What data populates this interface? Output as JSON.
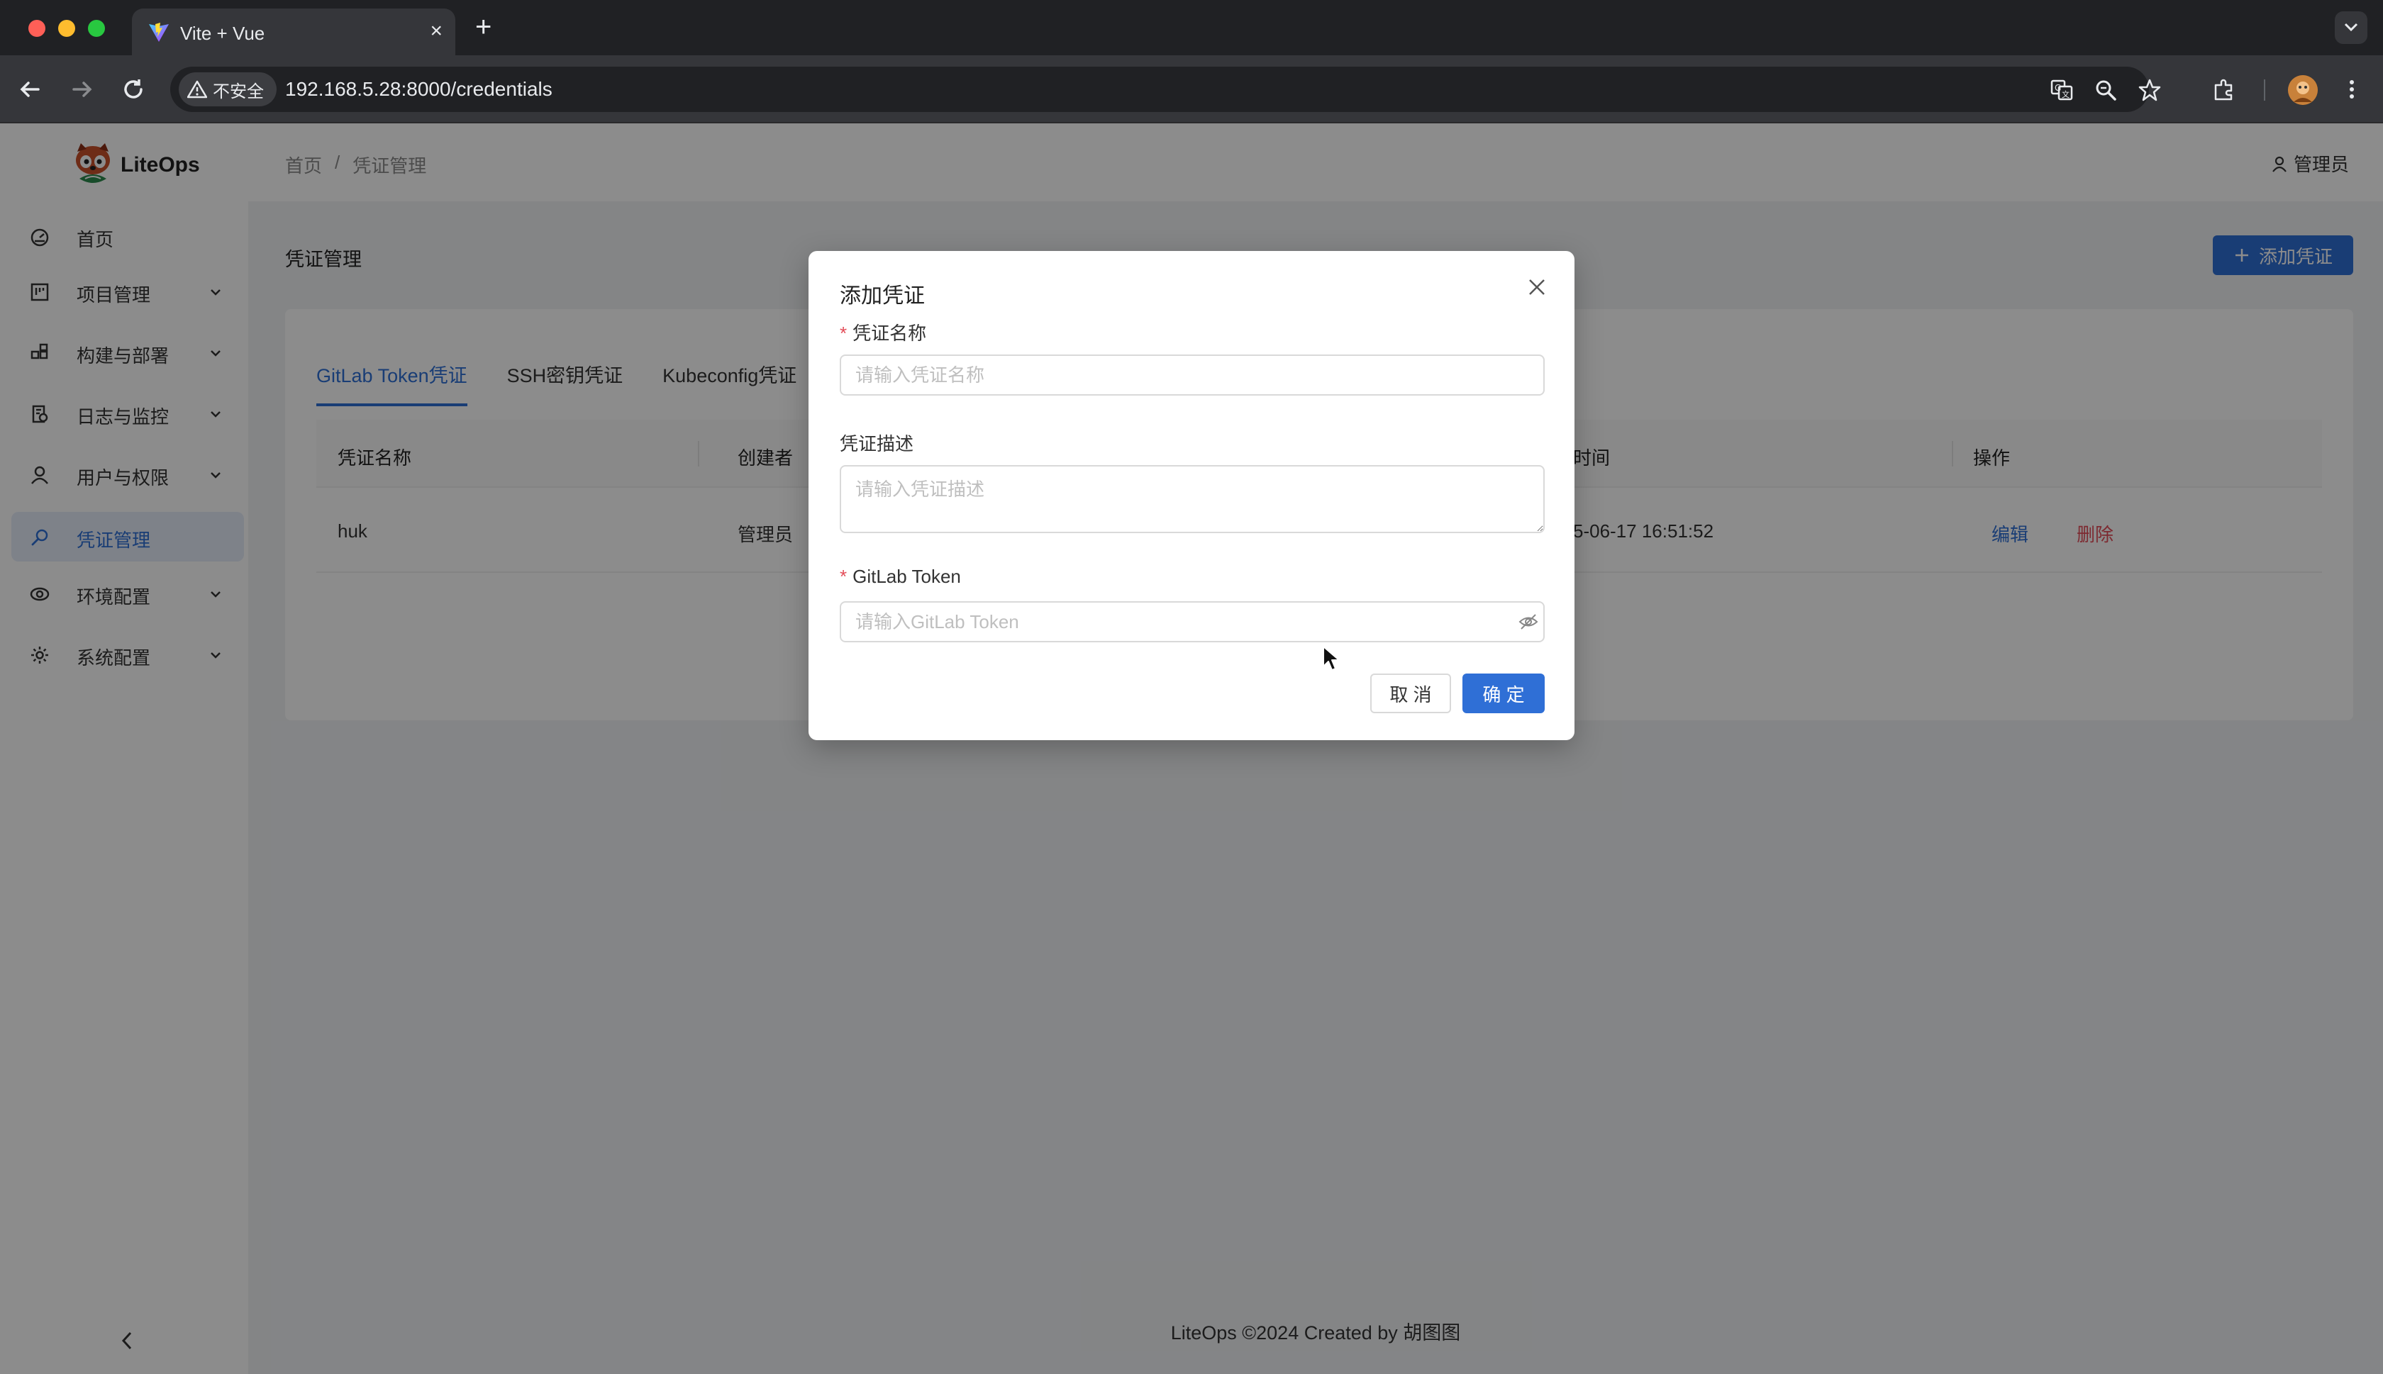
{
  "browser": {
    "tab_title": "Vite + Vue",
    "security_label": "不安全",
    "url": "192.168.5.28:8000/credentials"
  },
  "app": {
    "logo_text": "LiteOps",
    "user_name": "管理员",
    "breadcrumb": [
      "首页",
      "/",
      "凭证管理"
    ],
    "page_title": "凭证管理",
    "add_button_label": "添加凭证",
    "footer": "LiteOps ©2024 Created by 胡图图"
  },
  "sidebar": {
    "items": [
      {
        "label": "首页",
        "icon": "dashboard-icon"
      },
      {
        "label": "项目管理",
        "icon": "project-icon"
      },
      {
        "label": "构建与部署",
        "icon": "build-icon"
      },
      {
        "label": "日志与监控",
        "icon": "log-icon"
      },
      {
        "label": "用户与权限",
        "icon": "user-icon"
      },
      {
        "label": "凭证管理",
        "icon": "key-icon"
      },
      {
        "label": "环境配置",
        "icon": "environment-icon"
      },
      {
        "label": "系统配置",
        "icon": "settings-icon"
      }
    ]
  },
  "tabs": [
    "GitLab Token凭证",
    "SSH密钥凭证",
    "Kubeconfig凭证"
  ],
  "table": {
    "columns": [
      "凭证名称",
      "创建者",
      "时间",
      "操作"
    ],
    "rows": [
      {
        "name": "huk",
        "creator": "管理员",
        "time": "5-06-17 16:51:52",
        "edit": "编辑",
        "delete": "删除"
      }
    ]
  },
  "modal": {
    "title": "添加凭证",
    "fields": {
      "name_label": "凭证名称",
      "name_placeholder": "请输入凭证名称",
      "desc_label": "凭证描述",
      "desc_placeholder": "请输入凭证描述",
      "token_label": "GitLab Token",
      "token_placeholder": "请输入GitLab Token"
    },
    "cancel_label": "取 消",
    "ok_label": "确 定"
  },
  "colors": {
    "primary": "#2f6fd6",
    "danger": "#e34d59"
  }
}
